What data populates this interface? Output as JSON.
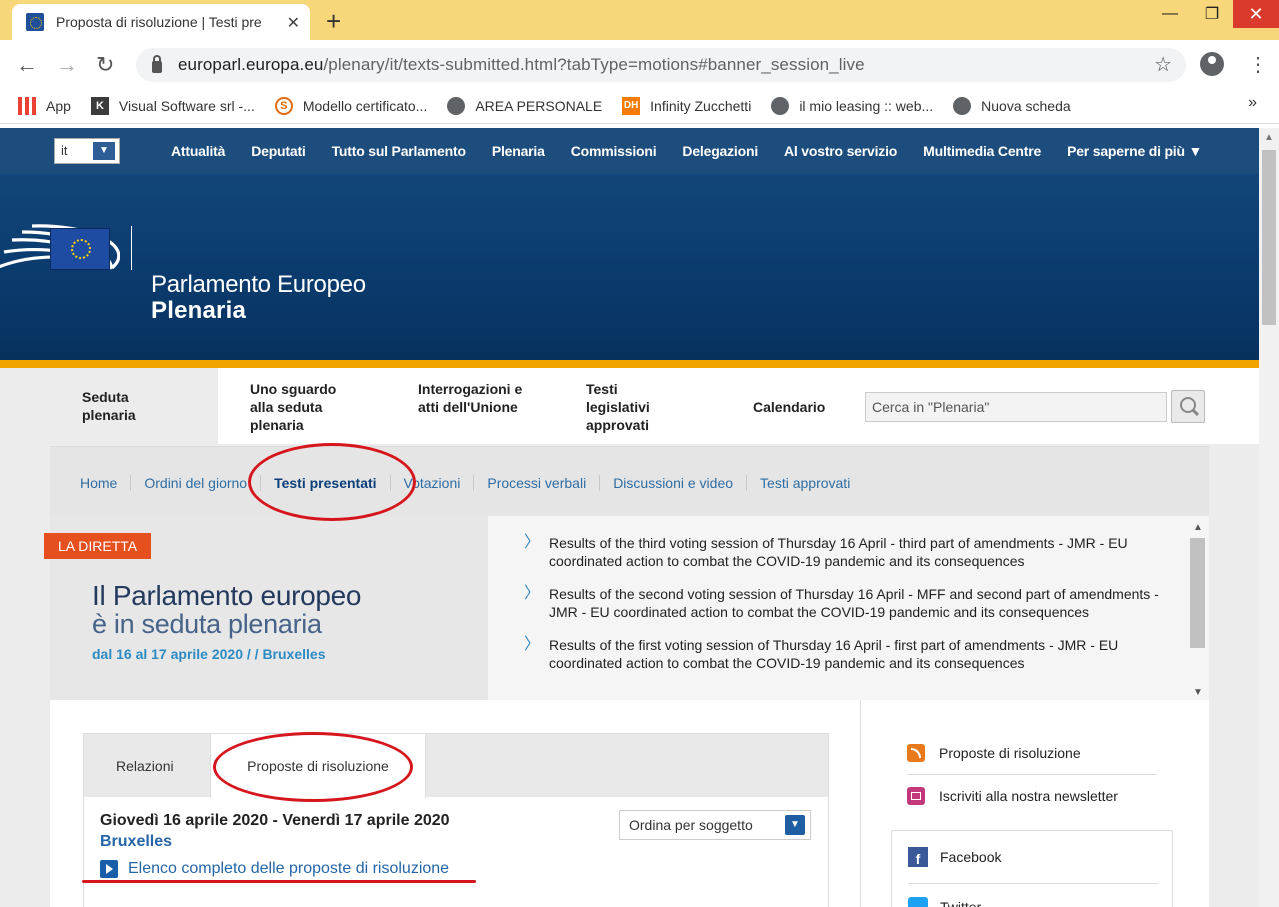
{
  "browser": {
    "tab_title": "Proposta di risoluzione | Testi pre",
    "url_host": "europarl.europa.eu",
    "url_path": "/plenary/it/texts-submitted.html?tabType=motions#banner_session_live",
    "bookmarks": [
      {
        "label": "App",
        "icon": "apps-icon"
      },
      {
        "label": "Visual Software srl -...",
        "icon": "k-logo-icon"
      },
      {
        "label": "Modello certificato...",
        "icon": "s-logo-icon"
      },
      {
        "label": "AREA PERSONALE",
        "icon": "globe-icon"
      },
      {
        "label": "Infinity Zucchetti",
        "icon": "dh-logo-icon"
      },
      {
        "label": "il mio leasing :: web...",
        "icon": "globe-icon"
      },
      {
        "label": "Nuova scheda",
        "icon": "globe-icon"
      }
    ]
  },
  "site": {
    "language": "it",
    "topnav": [
      "Attualità",
      "Deputati",
      "Tutto sul Parlamento",
      "Plenaria",
      "Commissioni",
      "Delegazioni",
      "Al vostro servizio",
      "Multimedia Centre",
      "Per saperne di più ▼"
    ],
    "banner_title": "Parlamento Europeo",
    "banner_subtitle": "Plenaria",
    "subnav": {
      "seduta": "Seduta plenaria",
      "sguardo": "Uno sguardo alla seduta plenaria",
      "interrogazioni": "Interrogazioni e atti dell'Unione",
      "testi": "Testi legislativi approvati",
      "calendario": "Calendario"
    },
    "search_placeholder": "Cerca in \"Plenaria\"",
    "breadcrumb": [
      "Home",
      "Ordini del giorno",
      "Testi presentati",
      "Votazioni",
      "Processi verbali",
      "Discussioni e video",
      "Testi approvati"
    ],
    "live": {
      "badge": "LA DIRETTA",
      "line1": "Il Parlamento europeo",
      "line2": "è in seduta plenaria",
      "dates": "dal 16 al 17 aprile 2020 / / Bruxelles"
    },
    "news": [
      "Results of the third voting session of Thursday 16 April - third part of amendments - JMR - EU coordinated action to combat the COVID-19 pandemic and its consequences",
      "Results of the second voting session of Thursday 16 April - MFF and second part of amendments - JMR - EU coordinated action to combat the COVID-19 pandemic and its consequences",
      "Results of the first voting session of Thursday 16 April - first part of amendments - JMR - EU coordinated action to combat the COVID-19 pandemic and its consequences"
    ],
    "tabs": {
      "relazioni": "Relazioni",
      "proposte": "Proposte di risoluzione"
    },
    "session_date": "Giovedì 16 aprile 2020 - Venerdì 17 aprile 2020",
    "session_place": "Bruxelles",
    "full_list_link": "Elenco completo delle proposte di risoluzione",
    "sort_by": "Ordina per soggetto",
    "sidebar": {
      "rss": "Proposte di risoluzione",
      "newsletter": "Iscriviti alla nostra newsletter",
      "facebook": "Facebook",
      "twitter": "Twitter"
    }
  },
  "colors": {
    "annotation": "#d6161d",
    "nav_blue": "#1c4d7c",
    "accent_orange": "#f1a400",
    "live_badge": "#e6501e"
  }
}
